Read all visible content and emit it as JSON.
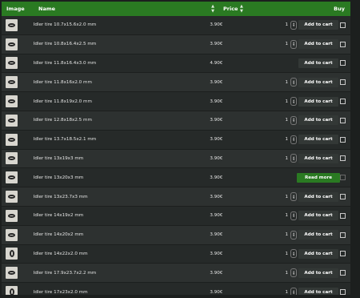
{
  "table": {
    "columns": {
      "image": "Image",
      "name": "Name",
      "price": "Price",
      "buy": "Buy"
    },
    "rows": [
      {
        "name": "Idler tire 10.7x15.6x2.0 mm",
        "price": "3.90€",
        "qty": "1",
        "action": "Add to cart",
        "thumb_icon": "tire-icon-dark"
      },
      {
        "name": "Idler tire 10.8x16.4x2.5 mm",
        "price": "3.90€",
        "qty": "1",
        "action": "Add to cart",
        "thumb_icon": "tire-icon"
      },
      {
        "name": "Idler tire 11.8x16.4x3.0 mm",
        "price": "4.90€",
        "qty": "",
        "action": "Add to cart",
        "thumb_icon": "tire-icon"
      },
      {
        "name": "Idler tire 11.8x16x2.0 mm",
        "price": "3.90€",
        "qty": "1",
        "action": "Add to cart",
        "thumb_icon": "tire-icon"
      },
      {
        "name": "Idler tire 11.8x19x2.0 mm",
        "price": "3.90€",
        "qty": "1",
        "action": "Add to cart",
        "thumb_icon": "tire-icon"
      },
      {
        "name": "Idler tire 12.8x18x2.5 mm",
        "price": "3.90€",
        "qty": "1",
        "action": "Add to cart",
        "thumb_icon": "tire-icon"
      },
      {
        "name": "Idler tire 13.7x18.5x2.1 mm",
        "price": "3.90€",
        "qty": "1",
        "action": "Add to cart",
        "thumb_icon": "tire-icon"
      },
      {
        "name": "Idler tire 13x19x3 mm",
        "price": "3.90€",
        "qty": "1",
        "action": "Add to cart",
        "thumb_icon": "tire-icon"
      },
      {
        "name": "Idler tire 13x20x3 mm",
        "price": "3.90€",
        "qty": "",
        "action": "Read more",
        "thumb_icon": "tire-icon"
      },
      {
        "name": "Idler tire 13x23.7x3 mm",
        "price": "3.90€",
        "qty": "1",
        "action": "Add to cart",
        "thumb_icon": "tire-icon"
      },
      {
        "name": "Idler tire 14x19x2 mm",
        "price": "3.90€",
        "qty": "1",
        "action": "Add to cart",
        "thumb_icon": "tire-icon"
      },
      {
        "name": "Idler tire 14x20x2 mm",
        "price": "3.90€",
        "qty": "1",
        "action": "Add to cart",
        "thumb_icon": "tire-icon"
      },
      {
        "name": "Idler tire 14x22x2.0 mm",
        "price": "3.90€",
        "qty": "1",
        "action": "Add to cart",
        "thumb_icon": "tire-icon-tall"
      },
      {
        "name": "Idler tire 17.9x23.7x2.2 mm",
        "price": "3.90€",
        "qty": "1",
        "action": "Add to cart",
        "thumb_icon": "tire-icon"
      },
      {
        "name": "Idler tire 17x23x2.0 mm",
        "price": "3.90€",
        "qty": "1",
        "action": "Add to cart",
        "thumb_icon": "tire-icon-tall"
      }
    ]
  },
  "colors": {
    "header_bg": "#2a7a22",
    "read_more_bg": "#2a7a22",
    "button_bg": "#333836",
    "page_bg": "#1c1f1e"
  },
  "icons": {
    "sort": "sort-icon",
    "stepper": "qty-stepper-icon"
  }
}
